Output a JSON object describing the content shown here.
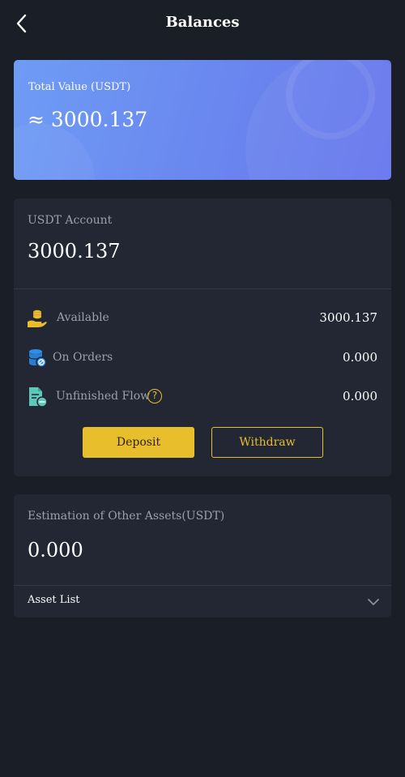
{
  "header": {
    "title": "Balances",
    "back_icon": "chevron-left-icon"
  },
  "total": {
    "label": "Total Value (USDT)",
    "value": "≈ 3000.137",
    "gradient": [
      "#6e9cf5",
      "#6676ec"
    ]
  },
  "usdt_account": {
    "label": "USDT Account",
    "amount": "3000.137",
    "rows": [
      {
        "icon": "coins-hand-icon",
        "label": "Available",
        "value": "3000.137"
      },
      {
        "icon": "database-blocked-icon",
        "label": "On Orders",
        "value": "0.000"
      },
      {
        "icon": "document-minus-icon",
        "label": "Unfinished Flow",
        "value": "0.000",
        "help_icon": "question-circle-icon",
        "help_glyph": "?"
      }
    ],
    "deposit_label": "Deposit",
    "withdraw_label": "Withdraw"
  },
  "other_assets": {
    "label": "Estimation of Other Assets(USDT)",
    "amount": "0.000",
    "asset_list_label": "Asset List",
    "expand_icon": "chevron-down-icon"
  },
  "colors": {
    "background": "#1a1e26",
    "card": "#222733",
    "accent": "#e8be2c",
    "muted_text": "#9aa0ab"
  }
}
